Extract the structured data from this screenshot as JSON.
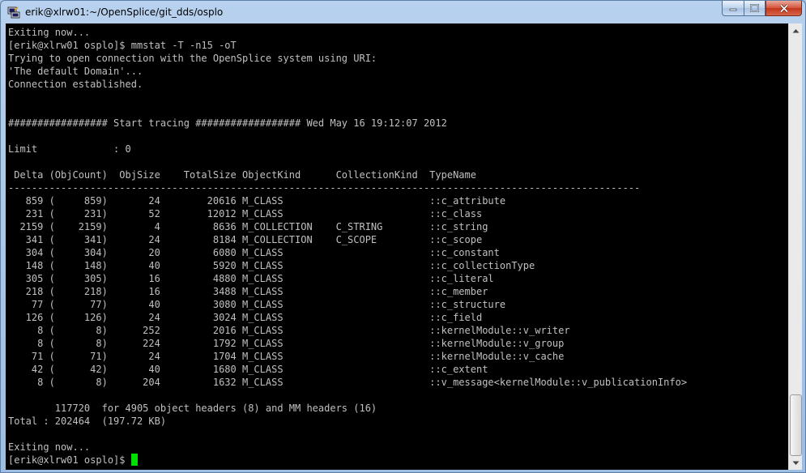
{
  "window": {
    "title": "erik@xlrw01:~/OpenSplice/git_dds/osplo",
    "icon": "putty-terminal-icon"
  },
  "terminal": {
    "lines": [
      "Exiting now...",
      "[erik@xlrw01 osplo]$ mmstat -T -n15 -oT",
      "Trying to open connection with the OpenSplice system using URI:",
      "'The default Domain'...",
      "Connection established.",
      "",
      "",
      "################# Start tracing ################## Wed May 16 19:12:07 2012",
      "",
      "Limit             : 0",
      "",
      " Delta (ObjCount)  ObjSize    TotalSize ObjectKind      CollectionKind  TypeName",
      "------------------------------------------------------------------------------------------------------------",
      "   859 (     859)       24        20616 M_CLASS                         ::c_attribute",
      "   231 (     231)       52        12012 M_CLASS                         ::c_class",
      "  2159 (    2159)        4         8636 M_COLLECTION    C_STRING        ::c_string",
      "   341 (     341)       24         8184 M_COLLECTION    C_SCOPE         ::c_scope",
      "   304 (     304)       20         6080 M_CLASS                         ::c_constant",
      "   148 (     148)       40         5920 M_CLASS                         ::c_collectionType",
      "   305 (     305)       16         4880 M_CLASS                         ::c_literal",
      "   218 (     218)       16         3488 M_CLASS                         ::c_member",
      "    77 (      77)       40         3080 M_CLASS                         ::c_structure",
      "   126 (     126)       24         3024 M_CLASS                         ::c_field",
      "     8 (       8)      252         2016 M_CLASS                         ::kernelModule::v_writer",
      "     8 (       8)      224         1792 M_CLASS                         ::kernelModule::v_group",
      "    71 (      71)       24         1704 M_CLASS                         ::kernelModule::v_cache",
      "    42 (      42)       40         1680 M_CLASS                         ::c_extent",
      "     8 (       8)      204         1632 M_CLASS                         ::v_message<kernelModule::v_publicationInfo>",
      "",
      "        117720  for 4905 object headers (8) and MM headers (16)",
      "Total : 202464  (197.72 KB)",
      "",
      "Exiting now..."
    ],
    "prompt": "[erik@xlrw01 osplo]$ "
  },
  "colors": {
    "background": "#000000",
    "foreground": "#c0c0c0",
    "cursor": "#00e000"
  }
}
